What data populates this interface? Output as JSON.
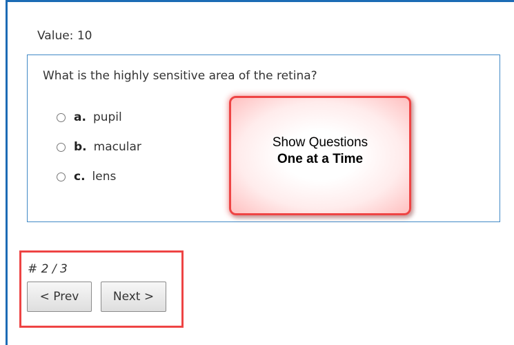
{
  "quiz": {
    "value_label": "Value: 10",
    "question": "What is the highly sensitive area of the retina?",
    "answers": [
      {
        "letter": "a.",
        "text": "pupil"
      },
      {
        "letter": "b.",
        "text": "macular"
      },
      {
        "letter": "c.",
        "text": "lens"
      }
    ]
  },
  "callout": {
    "line1": "Show Questions",
    "line2": "One at a Time"
  },
  "navigation": {
    "counter": "# 2 / 3",
    "prev_label": "< Prev",
    "next_label": "Next >"
  },
  "colors": {
    "frame_border": "#1c6bb5",
    "question_border": "#3f88c5",
    "highlight_red": "#ee4444"
  }
}
